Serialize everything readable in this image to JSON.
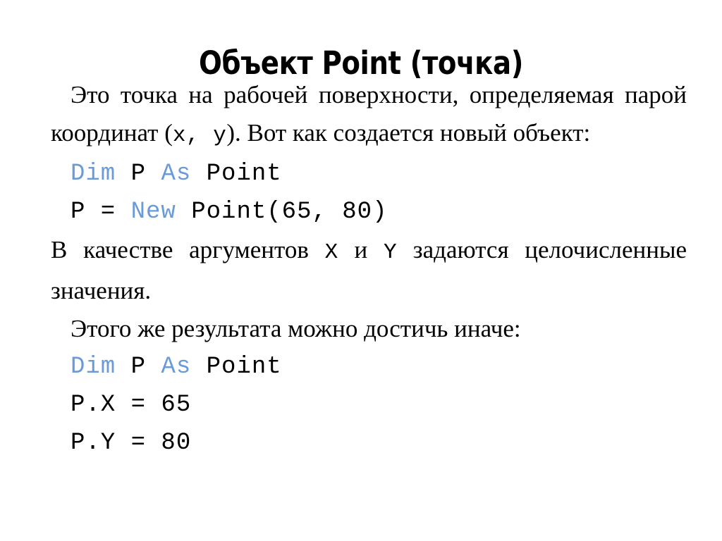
{
  "slide": {
    "title": "Объект Point (точка)",
    "background_color": "#ffffff",
    "text_color": "#000000",
    "keyword_color": "#6a9bd8"
  },
  "paragraph_1": {
    "part_1": "Это точка на рабочей поверхности, определяемая парой координат (",
    "code_x": "x,",
    "space": " ",
    "code_y": "y",
    "part_2": "). Вот как создается новый объект:"
  },
  "code_block_1": {
    "line_1": {
      "kw_dim": "Dim",
      "sep_1": " ",
      "var_p": "P",
      "sep_2": " ",
      "kw_as": "As",
      "sep_3": " ",
      "type_point": "Point"
    },
    "line_2": {
      "var_p": "P = ",
      "kw_new": "New",
      "call": " Point(65, 80)"
    }
  },
  "paragraph_2": {
    "part_1": "В качестве аргументов ",
    "code_x": "X",
    "part_2": " и ",
    "code_y": "Y",
    "part_3": " задаются целочисленные значения."
  },
  "paragraph_3": {
    "text": "Этого же результата можно достичь иначе:"
  },
  "code_block_2": {
    "line_1": {
      "kw_dim": "Dim",
      "sep_1": " ",
      "var_p": "P",
      "sep_2": " ",
      "kw_as": "As",
      "sep_3": " ",
      "type_point": "Point"
    },
    "line_2": "P.X = 65",
    "line_3": "P.Y = 80"
  }
}
